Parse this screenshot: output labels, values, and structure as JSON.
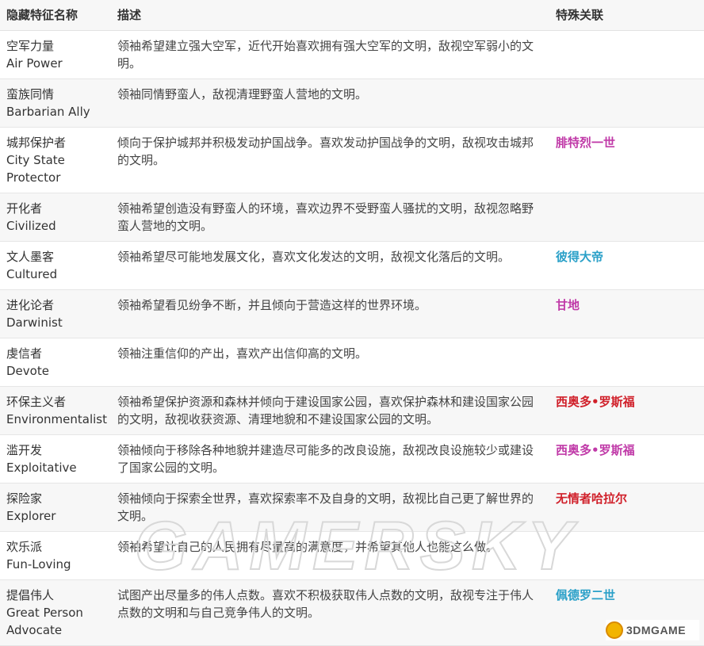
{
  "table": {
    "headers": [
      "隐藏特征名称",
      "描述",
      "特殊关联"
    ],
    "rows": [
      {
        "name_cn": "空军力量",
        "name_en": "Air Power",
        "desc": "领袖希望建立强大空军，近代开始喜欢拥有强大空军的文明，敌视空军弱小的文明。",
        "relation": "",
        "relation_color": ""
      },
      {
        "name_cn": "蛮族同情",
        "name_en": "Barbarian Ally",
        "desc": "领袖同情野蛮人，敌视清理野蛮人营地的文明。",
        "relation": "",
        "relation_color": ""
      },
      {
        "name_cn": "城邦保护者",
        "name_en": "City State Protector",
        "desc": "倾向于保护城邦并积极发动护国战争。喜欢发动护国战争的文明，敌视攻击城邦的文明。",
        "relation": "腓特烈一世",
        "relation_color": "#c03aa8"
      },
      {
        "name_cn": "开化者",
        "name_en": "Civilized",
        "desc": "领袖希望创造没有野蛮人的环境，喜欢边界不受野蛮人骚扰的文明，敌视忽略野蛮人营地的文明。",
        "relation": "",
        "relation_color": ""
      },
      {
        "name_cn": "文人墨客",
        "name_en": "Cultured",
        "desc": "领袖希望尽可能地发展文化，喜欢文化发达的文明，敌视文化落后的文明。",
        "relation": "彼得大帝",
        "relation_color": "#2aa0c8"
      },
      {
        "name_cn": "进化论者",
        "name_en": "Darwinist",
        "desc": "领袖希望看见纷争不断，并且倾向于营造这样的世界环境。",
        "relation": "甘地",
        "relation_color": "#c03aa8"
      },
      {
        "name_cn": "虔信者",
        "name_en": "Devote",
        "desc": "领袖注重信仰的产出，喜欢产出信仰高的文明。",
        "relation": "",
        "relation_color": ""
      },
      {
        "name_cn": "环保主义者",
        "name_en": "Environmentalist",
        "desc": "领袖希望保护资源和森林并倾向于建设国家公园，喜欢保护森林和建设国家公园的文明，敌视收获资源、清理地貌和不建设国家公园的文明。",
        "relation": "西奥多•罗斯福",
        "relation_color": "#d0202a"
      },
      {
        "name_cn": "滥开发",
        "name_en": "Exploitative",
        "desc": "领袖倾向于移除各种地貌并建造尽可能多的改良设施，敌视改良设施较少或建设了国家公园的文明。",
        "relation": "西奥多•罗斯福",
        "relation_color": "#c03aa8"
      },
      {
        "name_cn": "探险家",
        "name_en": "Explorer",
        "desc": "领袖倾向于探索全世界，喜欢探索率不及自身的文明，敌视比自己更了解世界的文明。",
        "relation": "无情者哈拉尔",
        "relation_color": "#d0202a"
      },
      {
        "name_cn": "欢乐派",
        "name_en": "Fun-Loving",
        "desc": "领袖希望让自己的人民拥有尽量高的满意度，并希望其他人也能这么做。",
        "relation": "",
        "relation_color": ""
      },
      {
        "name_cn": "提倡伟人",
        "name_en": "Great Person Advocate",
        "desc": "试图产出尽量多的伟人点数。喜欢不积极获取伟人点数的文明，敌视专注于伟人点数的文明和与自己竞争伟人的文明。",
        "relation": "佩德罗二世",
        "relation_color": "#2aa0c8"
      }
    ]
  },
  "watermark": {
    "text": "GAMERSKY"
  },
  "logo": {
    "text": "3DMGAME",
    "icon": "mascot-icon"
  }
}
